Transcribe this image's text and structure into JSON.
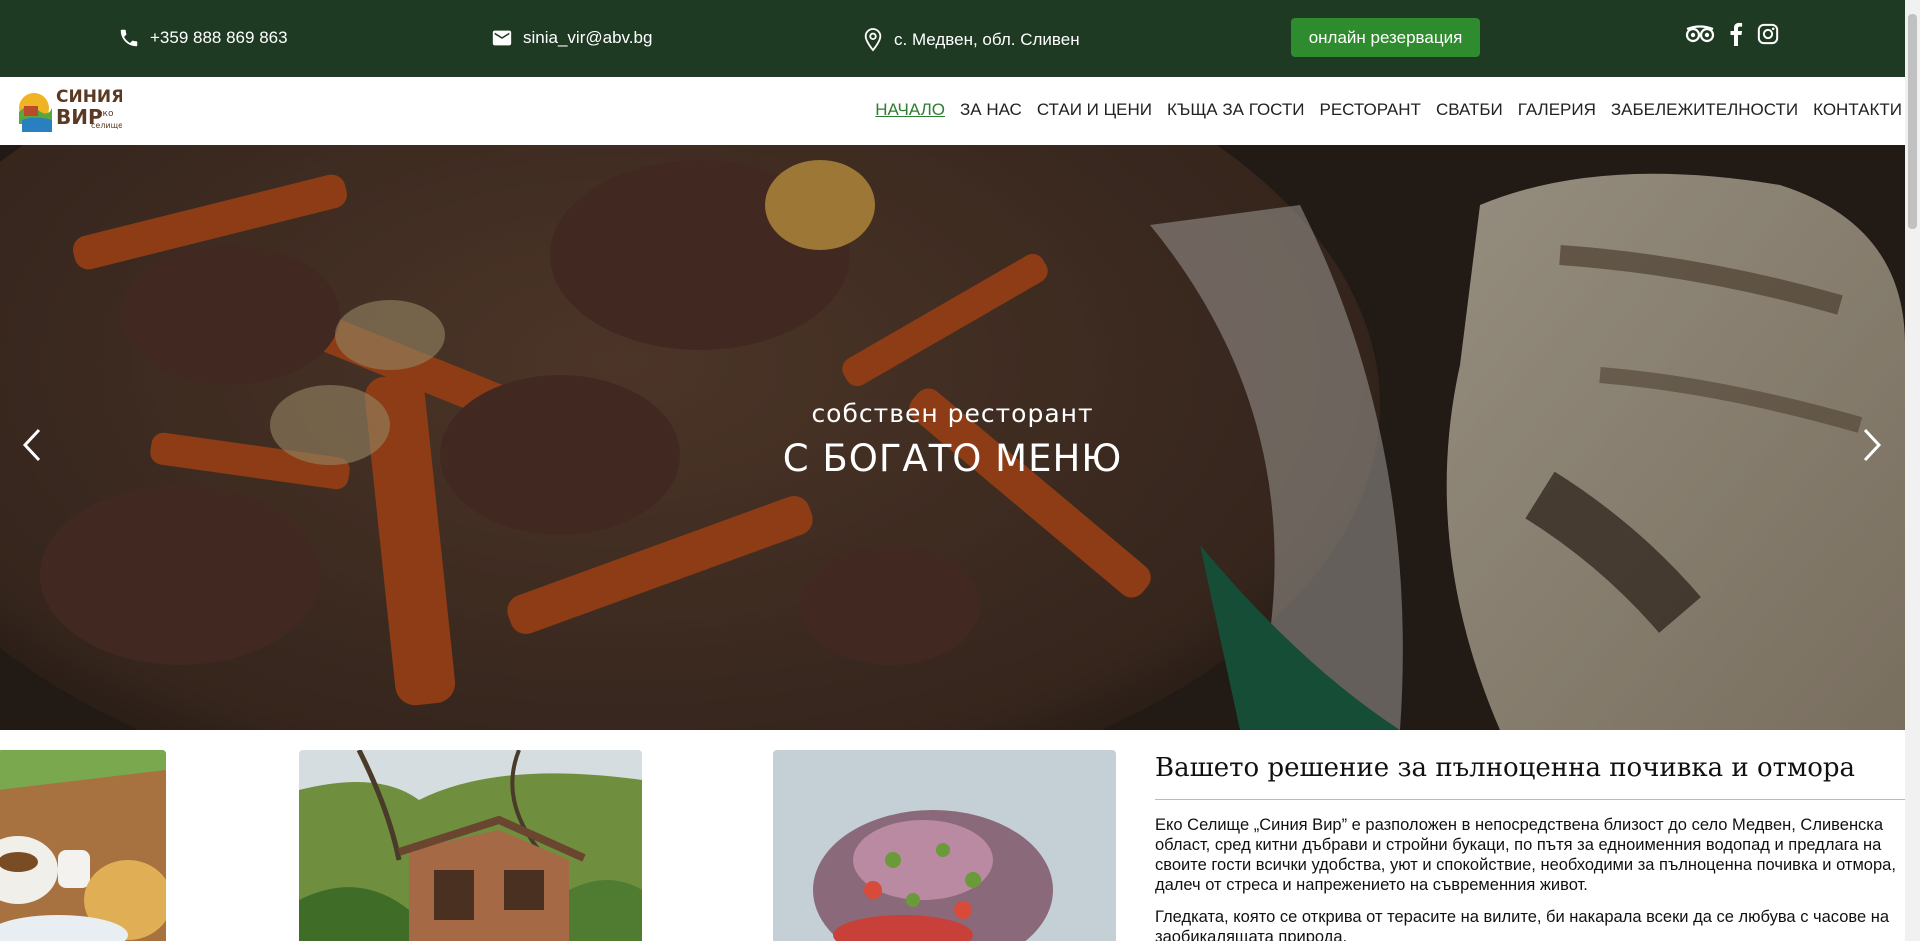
{
  "topbar": {
    "phone": "+359 888 869 863",
    "email": "sinia_vir@abv.bg",
    "location": "с. Медвен, обл. Сливен",
    "reserve_label": "онлайн резервация",
    "socials": [
      "tripadvisor-icon",
      "facebook-icon",
      "instagram-icon"
    ]
  },
  "logo": {
    "line1": "СИНИЯ",
    "line2": "ВИР",
    "tag1": "еко",
    "tag2": "селище"
  },
  "nav": [
    "НАЧАЛО",
    "ЗА НАС",
    "СТАИ И ЦЕНИ",
    "КЪЩА ЗА ГОСТИ",
    "РЕСТОРАНТ",
    "СВАТБИ",
    "ГАЛЕРИЯ",
    "ЗАБЕЛЕЖИТЕЛНОСТИ",
    "КОНТАКТИ"
  ],
  "hero": {
    "subtitle": "собствен ресторант",
    "title": "С БОГАТО МЕНЮ"
  },
  "about": {
    "heading": "Вашето решение за пълноценна почивка и отмора",
    "paragraph1": "Еко Селище „Синия Вир” е разположен в непосредствена близост до село Медвен, Сливенска област, сред китни дъбрави и стройни букаци, по пътя за едноименния водопад и предлага на своите гости всички удобства, уют и спокойствие, необходими за пълноценна почивка и отмора, далеч от стреса и напрежението на съвременния живот.",
    "paragraph2": "Гледката, която се открива от терасите на вилите, би накарала всеки да се любува с часове на заобикалящата природа."
  },
  "colors": {
    "topbar_bg": "#1e3a23",
    "button_green": "#2e8b2e",
    "nav_active": "#2e7d32"
  }
}
